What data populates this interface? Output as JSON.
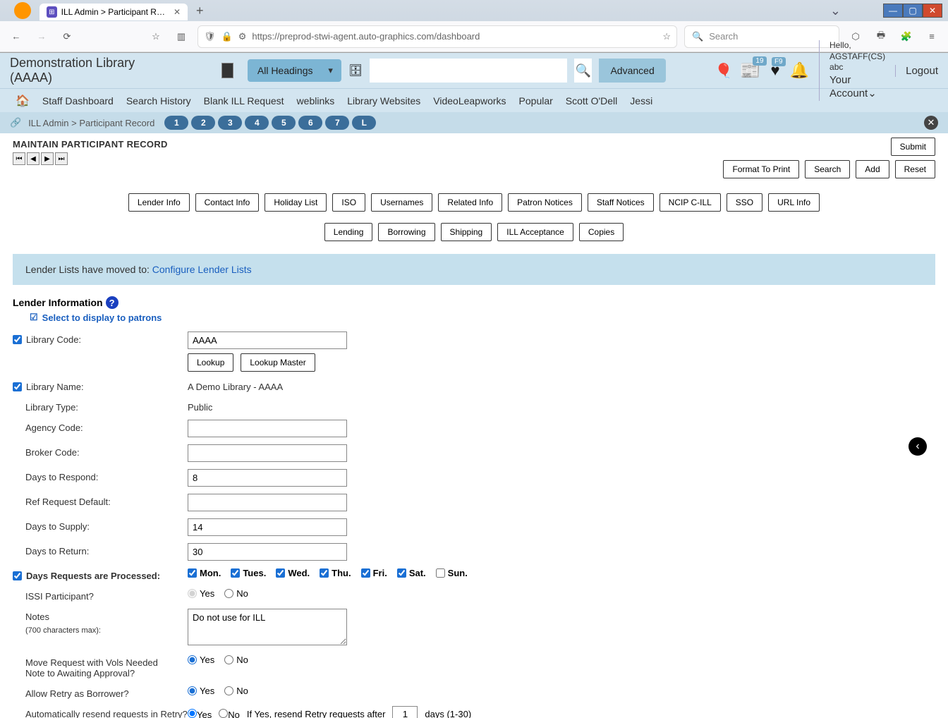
{
  "browser": {
    "tab_title": "ILL Admin > Participant Record",
    "url": "https://preprod-stwi-agent.auto-graphics.com/dashboard",
    "search_placeholder": "Search"
  },
  "header": {
    "library_title": "Demonstration Library (AAAA)",
    "headings_dropdown": "All Headings",
    "advanced": "Advanced",
    "msg_badge": "19",
    "fav_badge": "F9",
    "hello": "Hello, AGSTAFF(CS) abc",
    "your_account": "Your Account",
    "logout": "Logout"
  },
  "nav": {
    "items": [
      "Staff Dashboard",
      "Search History",
      "Blank ILL Request",
      "weblinks",
      "Library Websites",
      "VideoLeapworks",
      "Popular",
      "Scott O'Dell",
      "Jessi"
    ]
  },
  "context": {
    "breadcrumb_1": "ILL Admin",
    "breadcrumb_2": "Participant Record",
    "nums": [
      "1",
      "2",
      "3",
      "4",
      "5",
      "6",
      "7",
      "L"
    ]
  },
  "page": {
    "title": "MAINTAIN PARTICIPANT RECORD",
    "submit": "Submit",
    "format_to_print": "Format To Print",
    "search": "Search",
    "add": "Add",
    "reset": "Reset",
    "tabs": [
      "Lender Info",
      "Contact Info",
      "Holiday List",
      "ISO",
      "Usernames",
      "Related Info",
      "Patron Notices",
      "Staff Notices",
      "NCIP C-ILL",
      "SSO",
      "URL Info",
      "Lending",
      "Borrowing",
      "Shipping",
      "ILL Acceptance",
      "Copies"
    ],
    "banner_text": "Lender Lists have moved to: ",
    "banner_link": "Configure Lender Lists",
    "section_heading": "Lender Information",
    "select_display": "Select to display to patrons",
    "lookup": "Lookup",
    "lookup_master": "Lookup Master",
    "yes": "Yes",
    "no": "No"
  },
  "form": {
    "library_code_label": "Library Code:",
    "library_code": "AAAA",
    "library_name_label": "Library Name:",
    "library_name": "A Demo Library - AAAA",
    "library_type_label": "Library Type:",
    "library_type": "Public",
    "agency_code_label": "Agency Code:",
    "agency_code": "",
    "broker_code_label": "Broker Code:",
    "broker_code": "",
    "days_respond_label": "Days to Respond:",
    "days_respond": "8",
    "ref_request_label": "Ref Request Default:",
    "ref_request": "",
    "days_supply_label": "Days to Supply:",
    "days_supply": "14",
    "days_return_label": "Days to Return:",
    "days_return": "30",
    "days_processed_label": "Days Requests are Processed:",
    "days": {
      "mon": "Mon.",
      "tue": "Tues.",
      "wed": "Wed.",
      "thu": "Thu.",
      "fri": "Fri.",
      "sat": "Sat.",
      "sun": "Sun."
    },
    "issi_label": "ISSI Participant?",
    "notes_label": "Notes",
    "notes_sublabel": "(700 characters max):",
    "notes": "Do not use for ILL",
    "move_request_label": "Move Request with Vols Needed Note to Awaiting Approval?",
    "allow_retry_label": "Allow Retry as Borrower?",
    "auto_resend_label": "Automatically resend requests in Retry?",
    "resend_text_1": "If Yes, resend Retry requests after",
    "resend_val": "1",
    "resend_text_2": "days (1-30)"
  }
}
